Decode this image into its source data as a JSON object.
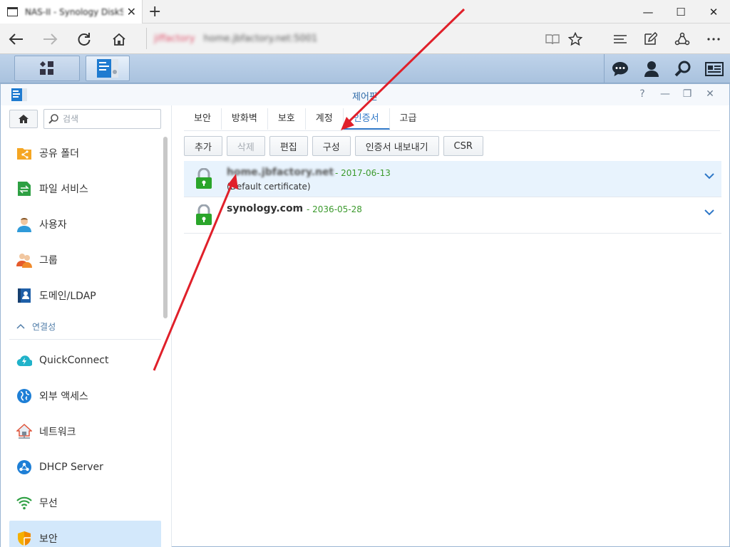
{
  "browser": {
    "tab_title": "NAS-II - Synology DiskStation",
    "url_host": "jiffactory",
    "url_rest": "home.jbfactory.net:5001",
    "close_symbol": "✕",
    "new_tab_symbol": "+",
    "minimize_symbol": "—",
    "maximize_symbol": "☐",
    "window_close_symbol": "✕"
  },
  "window": {
    "title": "제어판",
    "ctrl_help": "?",
    "ctrl_min": "—",
    "ctrl_max": "❐",
    "ctrl_close": "✕"
  },
  "sidebar": {
    "search_placeholder": "검색",
    "items_top": [
      {
        "label": "공유 폴더",
        "icon": "shared-folder-icon"
      },
      {
        "label": "파일 서비스",
        "icon": "file-services-icon"
      },
      {
        "label": "사용자",
        "icon": "user-icon"
      },
      {
        "label": "그룹",
        "icon": "group-icon"
      },
      {
        "label": "도메인/LDAP",
        "icon": "domain-ldap-icon"
      }
    ],
    "section_label": "연결성",
    "items_connectivity": [
      {
        "label": "QuickConnect",
        "icon": "quickconnect-icon"
      },
      {
        "label": "외부 액세스",
        "icon": "external-access-icon"
      },
      {
        "label": "네트워크",
        "icon": "network-icon"
      },
      {
        "label": "DHCP Server",
        "icon": "dhcp-server-icon"
      },
      {
        "label": "무선",
        "icon": "wireless-icon"
      },
      {
        "label": "보안",
        "icon": "security-icon"
      }
    ]
  },
  "tabs": [
    "보안",
    "방화벽",
    "보호",
    "계정",
    "인증서",
    "고급"
  ],
  "active_tab": "인증서",
  "toolbar": {
    "add": "추가",
    "delete": "삭제",
    "edit": "편집",
    "configure": "구성",
    "export": "인증서 내보내기",
    "csr": "CSR"
  },
  "certificates": [
    {
      "name": "home.jbfactory.net",
      "separator": " - ",
      "date": "2017-06-13",
      "note": "(Default certificate)"
    },
    {
      "name": "synology.com",
      "separator": " - ",
      "date": "2036-05-28",
      "note": ""
    }
  ],
  "colors": {
    "accent": "#2e77c7",
    "date_green": "#3c9a2d",
    "lock_green": "#2aa52a",
    "arrow_red": "#e0202a",
    "selected_row": "#e8f3fd"
  }
}
